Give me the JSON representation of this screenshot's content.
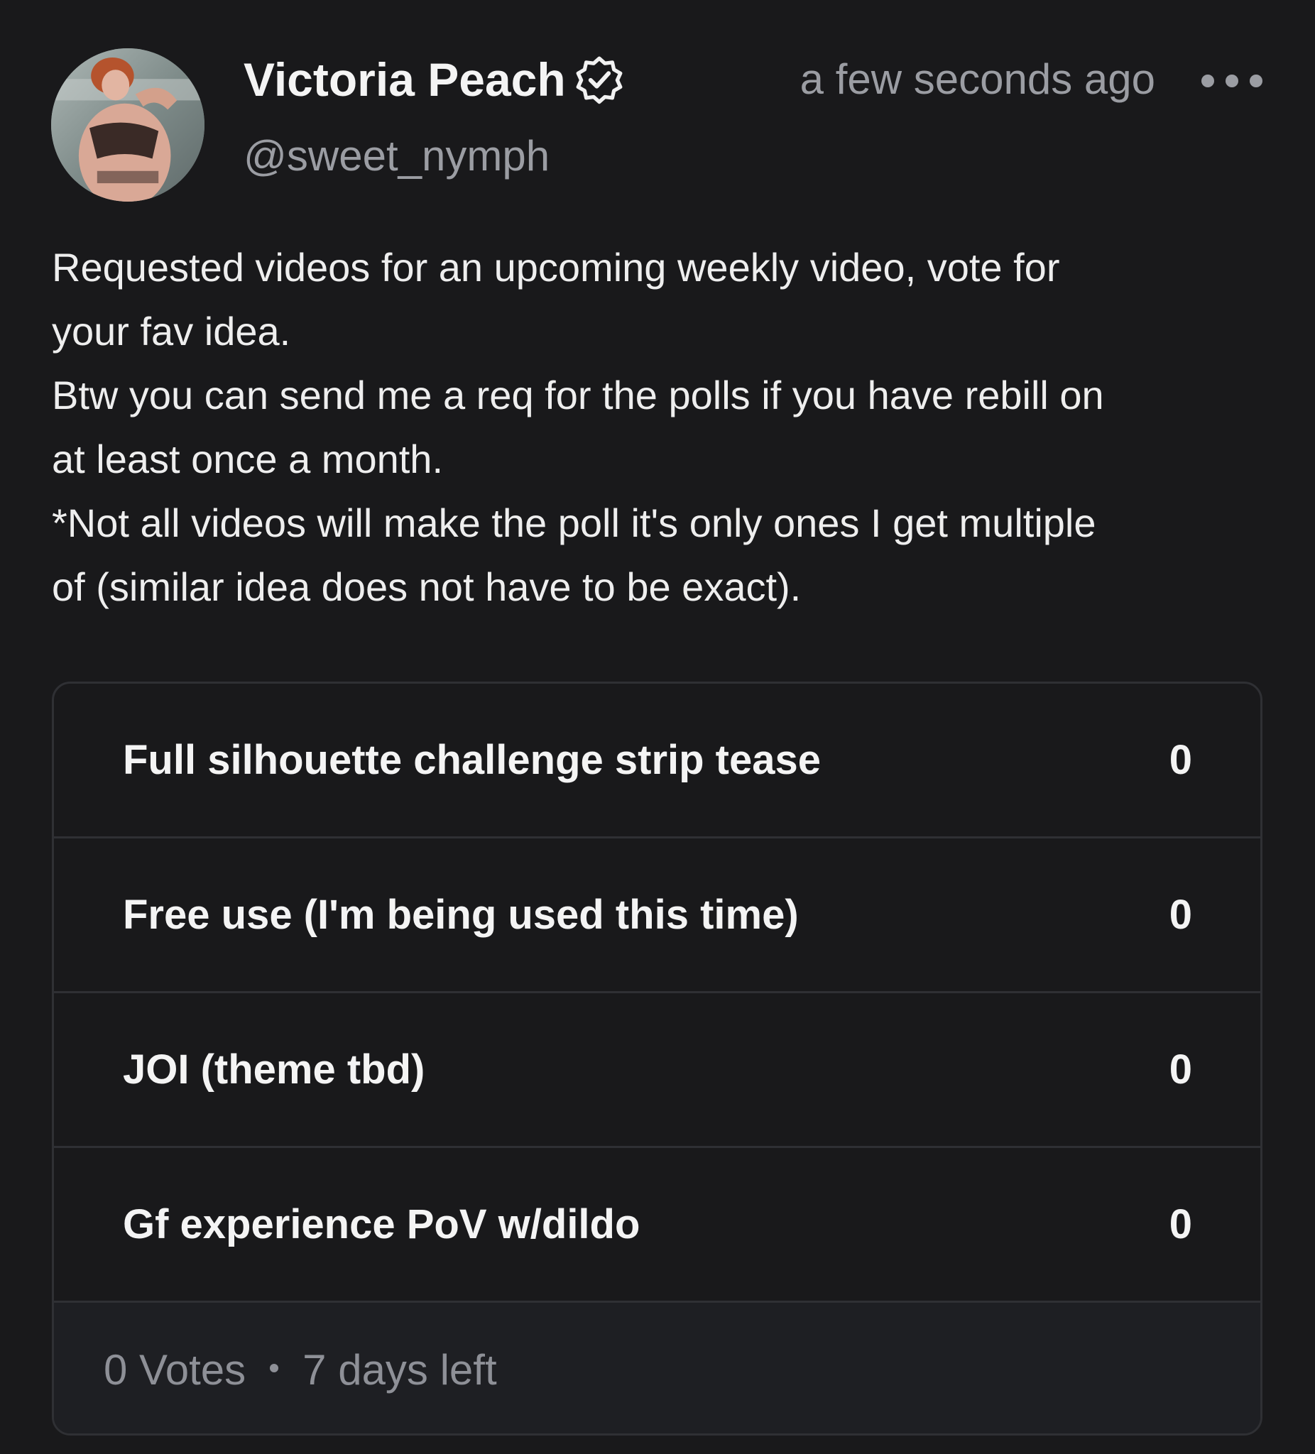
{
  "post": {
    "author": {
      "display_name": "Victoria Peach",
      "handle": "@sweet_nymph",
      "verified": true
    },
    "timestamp": "a few seconds ago",
    "more_icon": "ellipsis-horizontal-icon",
    "text_lines": [
      "Requested videos for an upcoming weekly video, vote for",
      "your fav idea.",
      "Btw you can send me a req for the polls if you have rebill on",
      "at least once a month.",
      "*Not all videos will make the poll it's only ones I get multiple",
      "of (similar idea does not have to be exact)."
    ]
  },
  "poll": {
    "options": [
      {
        "label": "Full silhouette challenge strip tease",
        "count": "0"
      },
      {
        "label": "Free use (I'm being used this time)",
        "count": "0"
      },
      {
        "label": "JOI (theme tbd)",
        "count": "0"
      },
      {
        "label": "Gf experience PoV w/dildo",
        "count": "0"
      }
    ],
    "votes": "0 Votes",
    "time_left": "7 days left"
  },
  "colors": {
    "background": "#19191b",
    "text_primary": "#f4f4f4",
    "text_secondary": "#9b9da3",
    "border": "#2f3034",
    "footer_bg": "#1e1f23"
  }
}
